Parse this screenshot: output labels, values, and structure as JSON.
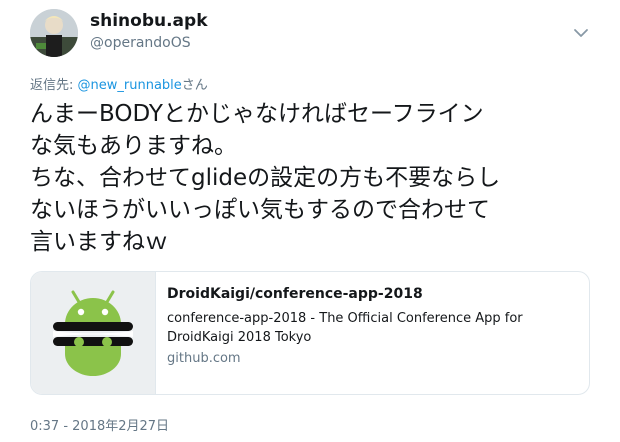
{
  "user": {
    "display_name": "shinobu.apk",
    "handle": "@operandoOS"
  },
  "reply": {
    "prefix": "返信先: ",
    "mention": "@new_runnable",
    "suffix": "さん"
  },
  "tweet": {
    "lines": [
      "んまーBODYとかじゃなければセーフライン",
      "な気もありますね。",
      "ちな、合わせてglideの設定の方も不要ならし",
      "ないほうがいいっぽい気もするので合わせて",
      "言いますねｗ"
    ]
  },
  "card": {
    "title": "DroidKaigi/conference-app-2018",
    "description_lines": [
      "conference-app-2018 - The Official Conference App for",
      "DroidKaigi 2018 Tokyo"
    ],
    "domain": "github.com",
    "image_icon": "android-logo"
  },
  "timestamp": "0:37 - 2018年2月27日",
  "icons": {
    "menu": "chevron-down-icon"
  },
  "colors": {
    "link": "#1b95e0",
    "secondary_text": "#657786",
    "android_green": "#8bc34a",
    "card_image_bg": "#eceff1"
  }
}
